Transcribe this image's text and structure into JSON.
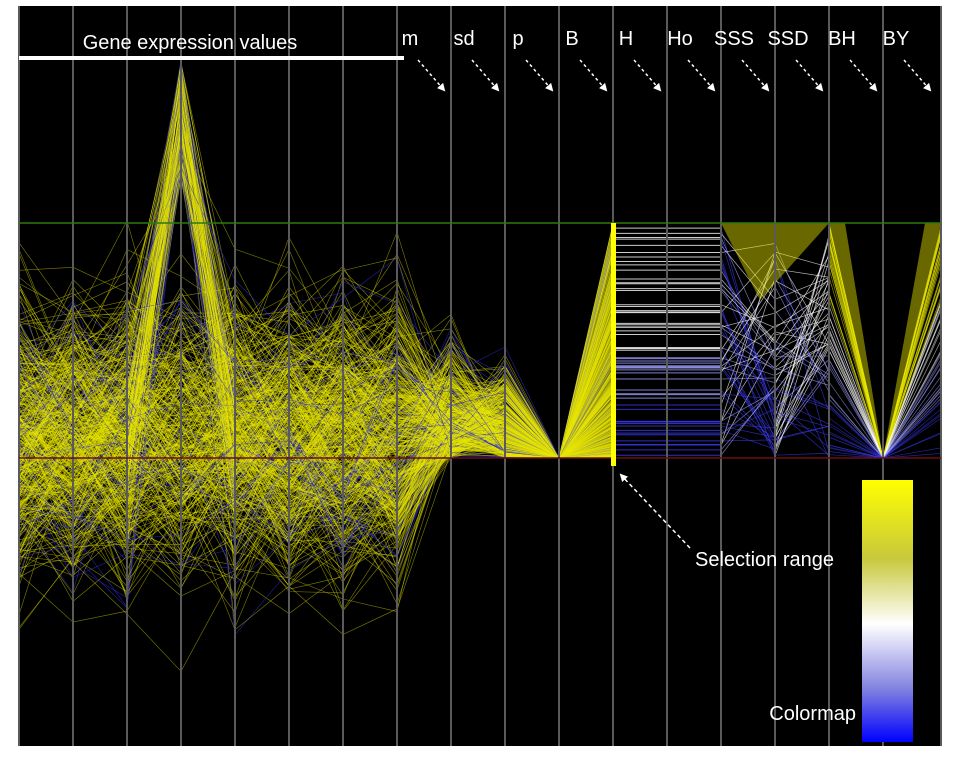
{
  "chart_data": {
    "type": "parallel-coordinates",
    "title": "Gene expression values",
    "axis_labels": [
      "m",
      "sd",
      "p",
      "B",
      "H",
      "Ho",
      "SSS",
      "SSD",
      "BH",
      "BY"
    ],
    "expression_axis_count": 7,
    "annotations": {
      "selection_range": "Selection range",
      "colormap": "Colormap"
    },
    "colormap_colors": [
      "#ffff00",
      "#ffffff",
      "#0000ff"
    ],
    "threshold_line_color": "#2a7a10",
    "baseline_line_color": "#6a1010",
    "selection_color": "#ffff00",
    "background_color": "#000000",
    "grid": true
  }
}
